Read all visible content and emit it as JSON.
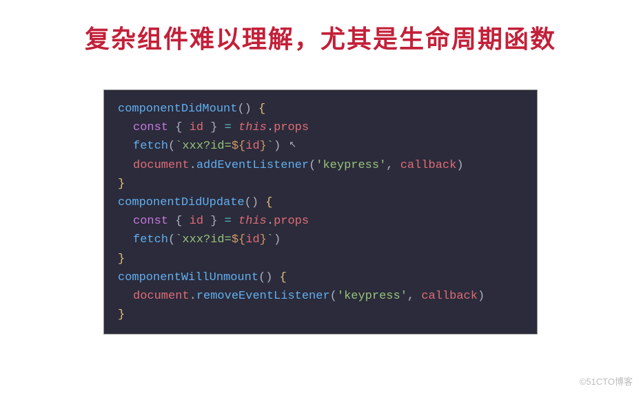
{
  "title": "复杂组件难以理解，尤其是生命周期函数",
  "code": {
    "fn1": "componentDidMount",
    "fn2": "componentDidUpdate",
    "fn3": "componentWillUnmount",
    "kw_const": "const",
    "destruct_open": " { ",
    "var_id": "id",
    "destruct_close": " } ",
    "eq": "= ",
    "this": "this",
    "dot": ".",
    "props": "props",
    "fetch": "fetch",
    "open_paren": "(",
    "close_paren": ")",
    "backtick": "`",
    "str_xxx": "xxx?id=",
    "interp_open": "${",
    "interp_var": "id",
    "interp_close": "}",
    "document": "document",
    "addEvt": "addEventListener",
    "removeEvt": "removeEventListener",
    "str_keypress": "'keypress'",
    "comma_sp": ", ",
    "callback": "callback",
    "empty_call": "() ",
    "brace_open": "{",
    "brace_close": "}"
  },
  "watermark": "©51CTO博客"
}
